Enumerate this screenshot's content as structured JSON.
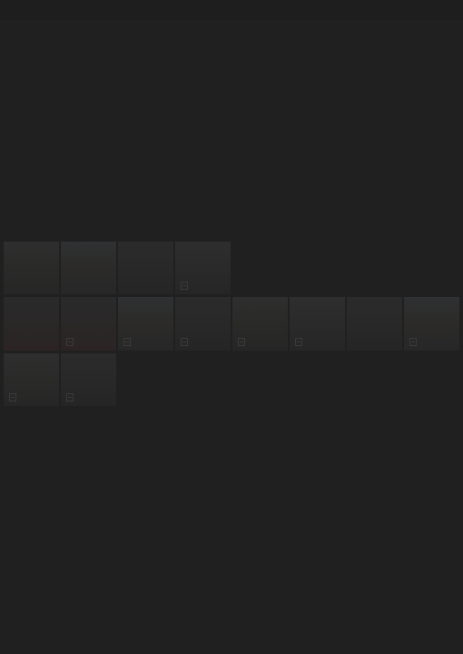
{
  "gallery": {
    "rows": [
      [
        {
          "icon": "image-placeholder-icon"
        },
        {
          "icon": "image-placeholder-icon"
        },
        {
          "icon": "image-placeholder-icon"
        },
        {
          "icon": "image-placeholder-icon"
        }
      ],
      [
        {
          "icon": "image-placeholder-icon"
        },
        {
          "icon": "image-placeholder-icon"
        },
        {
          "icon": "image-placeholder-icon"
        },
        {
          "icon": "image-placeholder-icon"
        },
        {
          "icon": "image-placeholder-icon"
        },
        {
          "icon": "image-placeholder-icon"
        },
        {
          "icon": "image-placeholder-icon"
        },
        {
          "icon": "image-placeholder-icon"
        }
      ],
      [
        {
          "icon": "image-placeholder-icon"
        },
        {
          "icon": "image-placeholder-icon"
        }
      ]
    ]
  },
  "colors": {
    "background": "#202020",
    "thumbnail": "#2a2a2a"
  }
}
